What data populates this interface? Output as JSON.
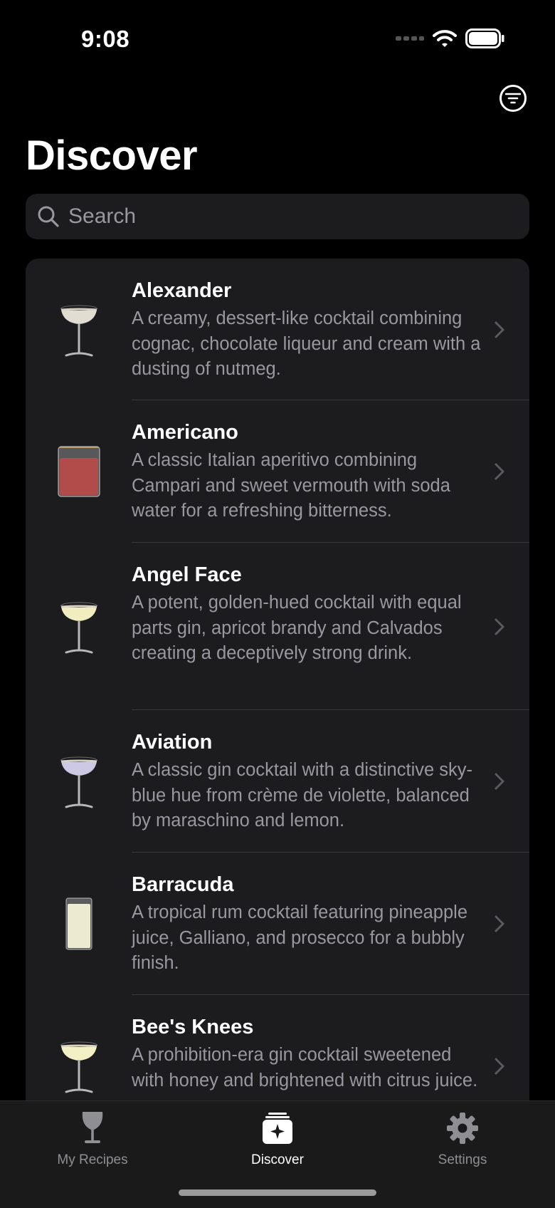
{
  "status_bar": {
    "time": "9:08"
  },
  "header": {
    "title": "Discover"
  },
  "search": {
    "placeholder": "Search"
  },
  "recipes": [
    {
      "name": "Alexander",
      "description": "A creamy, dessert-like cocktail combining cognac, chocolate liqueur and cream with a dusting of nutmeg.",
      "glass": "coupe",
      "color": "#e2ddd2"
    },
    {
      "name": "Americano",
      "description": "A classic Italian aperitivo combining Campari and sweet vermouth with soda water for a refreshing bitterness.",
      "glass": "rocks",
      "color": "#b24c4a"
    },
    {
      "name": "Angel Face",
      "description": "A potent, golden-hued cocktail with equal parts gin, apricot brandy and Calvados creating a deceptively strong drink.",
      "glass": "coupe",
      "color": "#f2edc0"
    },
    {
      "name": "Aviation",
      "description": "A classic gin cocktail with a distinctive sky-blue hue from crème de violette, balanced by maraschino and lemon.",
      "glass": "coupe",
      "color": "#cdc8e4"
    },
    {
      "name": "Barracuda",
      "description": "A tropical rum cocktail featuring pineapple juice, Galliano, and prosecco for a bubbly finish.",
      "glass": "highball",
      "color": "#ecebd0"
    },
    {
      "name": "Bee's Knees",
      "description": "A prohibition-era gin cocktail sweetened with honey and brightened with citrus juice.",
      "glass": "coupe",
      "color": "#f4f0c6"
    }
  ],
  "tabs": [
    {
      "label": "My Recipes",
      "icon": "wine-glass-icon",
      "active": false
    },
    {
      "label": "Discover",
      "icon": "discover-sparkle-icon",
      "active": true
    },
    {
      "label": "Settings",
      "icon": "gear-icon",
      "active": false
    }
  ]
}
